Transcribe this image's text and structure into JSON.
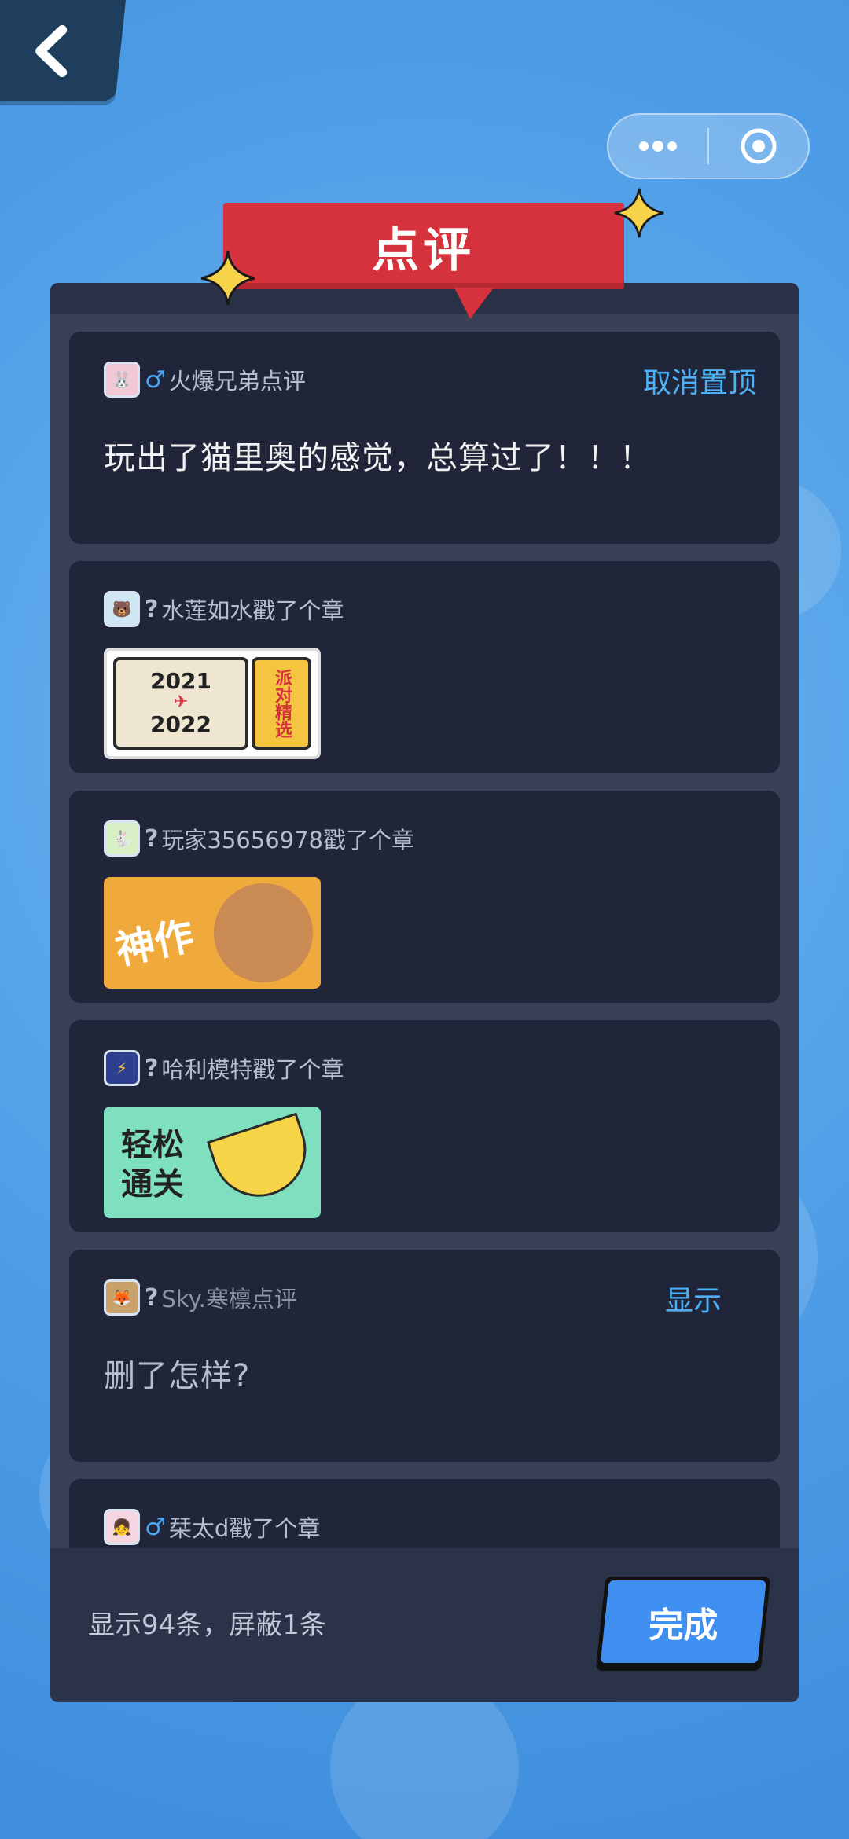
{
  "header": {
    "title": "点评"
  },
  "reviews": [
    {
      "gender": "♂",
      "user": "火爆兄弟点评",
      "action": "取消置顶",
      "text": "玩出了猫里奥的感觉，总算过了！！！"
    },
    {
      "gender": "?",
      "user": "水莲如水戳了个章",
      "stamp": {
        "top": "2021",
        "bottom": "2022",
        "side": "派对精选"
      }
    },
    {
      "gender": "?",
      "user": "玩家35656978戳了个章",
      "stamp": {
        "text": "神作"
      }
    },
    {
      "gender": "?",
      "user": "哈利模特戳了个章",
      "stamp": {
        "line1": "轻松",
        "line2": "通关"
      }
    },
    {
      "gender": "?",
      "user": "Sky.寒檩点评",
      "action": "显示",
      "text": "删了怎样?"
    },
    {
      "gender": "♂",
      "user": "栞太d戳了个章"
    }
  ],
  "footer": {
    "count": "显示94条，屏蔽1条",
    "done": "完成"
  },
  "icons": [
    "back-arrow-icon",
    "more-dots-icon",
    "target-icon",
    "star-icon"
  ],
  "colors": {
    "accent": "#4cb0f5",
    "ribbon": "#d6323e",
    "button": "#3f8ff0"
  }
}
